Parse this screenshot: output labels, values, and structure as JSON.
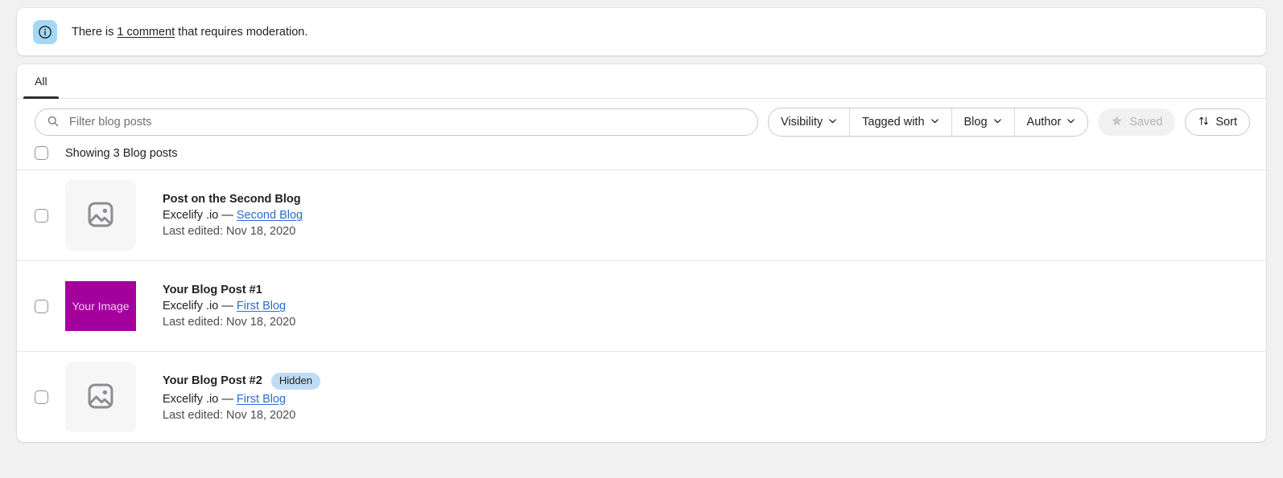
{
  "banner": {
    "icon": "info-circle-icon",
    "icon_bg": "#a4d8f5",
    "text_before": "There is ",
    "link_text": "1 comment",
    "text_after": " that requires moderation."
  },
  "tabs": [
    {
      "label": "All",
      "active": true
    }
  ],
  "search": {
    "icon": "search-icon",
    "placeholder": "Filter blog posts",
    "value": ""
  },
  "filters": [
    {
      "label": "Visibility",
      "icon": "chevron-down-icon"
    },
    {
      "label": "Tagged with",
      "icon": "chevron-down-icon"
    },
    {
      "label": "Blog",
      "icon": "chevron-down-icon"
    },
    {
      "label": "Author",
      "icon": "chevron-down-icon"
    }
  ],
  "saved_button": {
    "label": "Saved",
    "icon": "star-icon",
    "disabled": true
  },
  "sort_button": {
    "label": "Sort",
    "icon": "sort-arrows-icon"
  },
  "list": {
    "showing_label": "Showing 3 Blog posts",
    "select_all": false,
    "posts": [
      {
        "title": "Post on the Second Blog",
        "badge": null,
        "author": "Excelify .io",
        "separator": "—",
        "blog": "Second Blog",
        "date_label": "Last edited: Nov 18, 2020",
        "thumb": {
          "type": "placeholder",
          "icon": "image-placeholder-icon"
        }
      },
      {
        "title": "Your Blog Post #1",
        "badge": null,
        "author": "Excelify .io",
        "separator": "—",
        "blog": "First Blog",
        "date_label": "Last edited: Nov 18, 2020",
        "thumb": {
          "type": "image",
          "label": "Your Image",
          "color": "#a4009e"
        }
      },
      {
        "title": "Your Blog Post #2",
        "badge": "Hidden",
        "author": "Excelify .io",
        "separator": "—",
        "blog": "First Blog",
        "date_label": "Last edited: Nov 18, 2020",
        "thumb": {
          "type": "placeholder",
          "icon": "image-placeholder-icon"
        }
      }
    ]
  },
  "colors": {
    "page_bg": "#f1f1f1",
    "card_bg": "#ffffff",
    "link": "#2c6ecb",
    "badge_bg": "#bedcf5",
    "accent_dark": "#2c2d2e"
  }
}
